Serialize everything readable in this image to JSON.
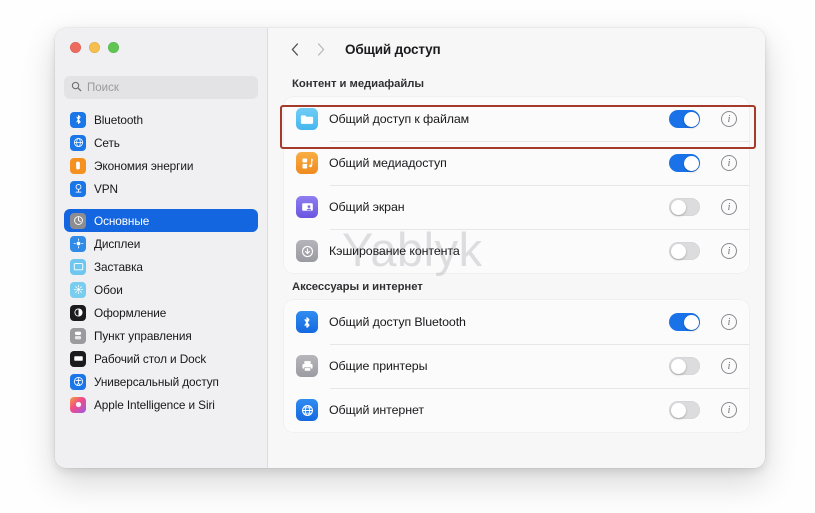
{
  "window": {
    "traffic_lights": [
      "close",
      "minimize",
      "zoom"
    ],
    "colors": {
      "close": "#ed6a5e",
      "minimize": "#f5bf4f",
      "zoom": "#61c554",
      "accent": "#1466e0",
      "toggle_on": "#1a72e8",
      "highlight": "#a33a2a"
    }
  },
  "sidebar": {
    "search": {
      "placeholder": "Поиск",
      "value": ""
    },
    "groups": [
      {
        "items": [
          {
            "label": "Bluetooth",
            "icon": "bluetooth-icon",
            "selected": false
          },
          {
            "label": "Сеть",
            "icon": "network-globe-icon",
            "selected": false
          },
          {
            "label": "Экономия энергии",
            "icon": "battery-energy-icon",
            "selected": false
          },
          {
            "label": "VPN",
            "icon": "vpn-icon",
            "selected": false
          }
        ]
      },
      {
        "items": [
          {
            "label": "Основные",
            "icon": "general-gear-icon",
            "selected": true
          },
          {
            "label": "Дисплеи",
            "icon": "displays-icon",
            "selected": false
          },
          {
            "label": "Заставка",
            "icon": "screensaver-icon",
            "selected": false
          },
          {
            "label": "Обои",
            "icon": "wallpaper-icon",
            "selected": false
          },
          {
            "label": "Оформление",
            "icon": "appearance-icon",
            "selected": false
          },
          {
            "label": "Пункт управления",
            "icon": "control-center-icon",
            "selected": false
          },
          {
            "label": "Рабочий стол и Dock",
            "icon": "desktop-dock-icon",
            "selected": false
          },
          {
            "label": "Универсальный доступ",
            "icon": "accessibility-icon",
            "selected": false
          },
          {
            "label": "Apple Intelligence и Siri",
            "icon": "siri-icon",
            "selected": false
          }
        ]
      }
    ]
  },
  "main": {
    "nav": {
      "back": "‹",
      "forward": "›"
    },
    "title": "Общий доступ",
    "sections": [
      {
        "heading": "Контент и медиафайлы",
        "rows": [
          {
            "label": "Общий доступ к файлам",
            "icon": "folder-icon",
            "toggle": "on",
            "info": "i",
            "highlighted": true
          },
          {
            "label": "Общий медиадоступ",
            "icon": "media-sharing-icon",
            "toggle": "on",
            "info": "i",
            "highlighted": false
          },
          {
            "label": "Общий экран",
            "icon": "screen-sharing-icon",
            "toggle": "off",
            "info": "i",
            "highlighted": false
          },
          {
            "label": "Кэширование контента",
            "icon": "content-caching-icon",
            "toggle": "off",
            "info": "i",
            "highlighted": false
          }
        ]
      },
      {
        "heading": "Аксессуары и интернет",
        "rows": [
          {
            "label": "Общий доступ Bluetooth",
            "icon": "bluetooth-icon",
            "toggle": "on",
            "info": "i",
            "highlighted": false
          },
          {
            "label": "Общие принтеры",
            "icon": "printer-icon",
            "toggle": "off",
            "info": "i",
            "highlighted": false
          },
          {
            "label": "Общий интернет",
            "icon": "internet-sharing-icon",
            "toggle": "off",
            "info": "i",
            "highlighted": false
          }
        ]
      }
    ]
  },
  "watermark": {
    "text": "Yablyk"
  }
}
